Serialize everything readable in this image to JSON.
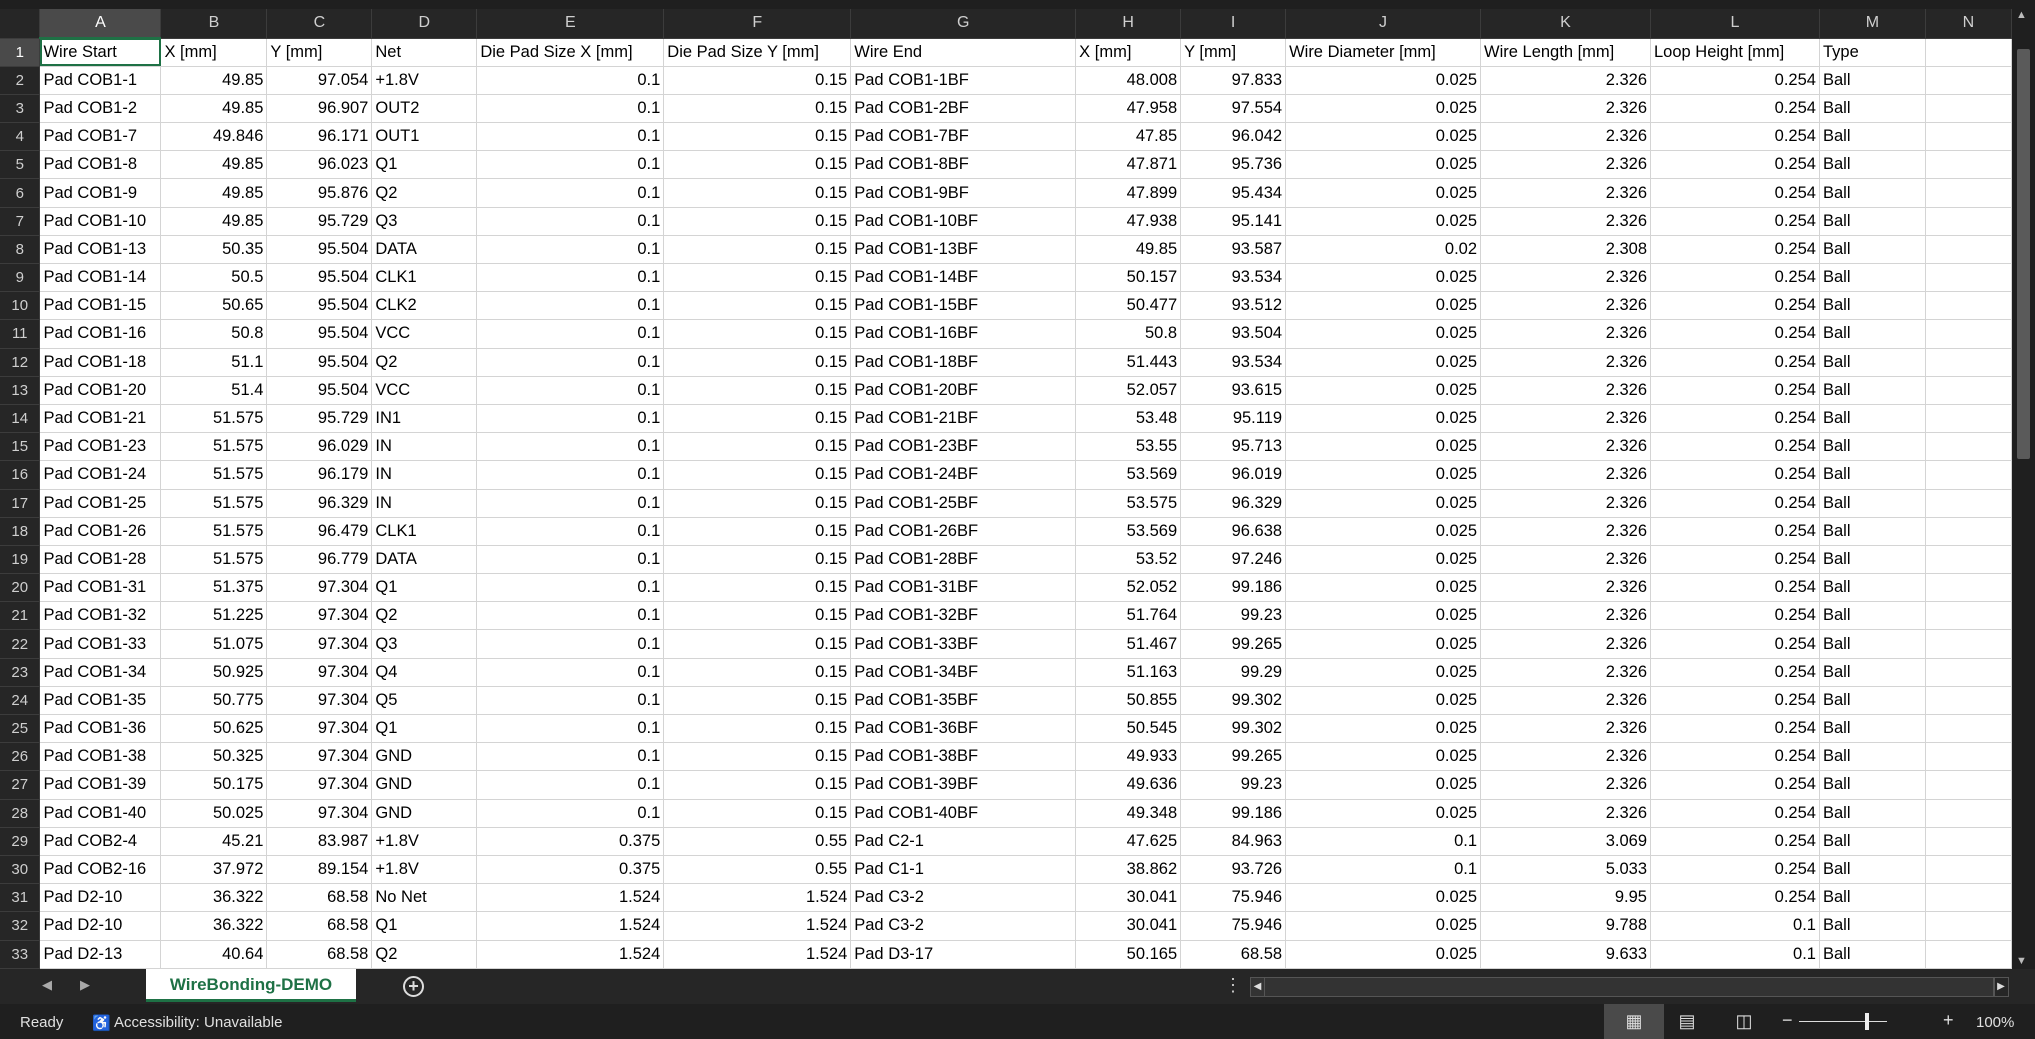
{
  "columns": [
    "A",
    "B",
    "C",
    "D",
    "E",
    "F",
    "G",
    "H",
    "I",
    "J",
    "K",
    "L",
    "M",
    "N"
  ],
  "numeric_columns": [
    1,
    2,
    4,
    5,
    7,
    8,
    9,
    10,
    11
  ],
  "header": [
    "Wire Start",
    "X [mm]",
    "Y [mm]",
    "Net",
    "Die Pad Size X [mm]",
    "Die Pad Size Y [mm]",
    "Wire End",
    "X [mm]",
    "Y [mm]",
    "Wire Diameter [mm]",
    "Wire Length [mm]",
    "Loop Height [mm]",
    "Type",
    ""
  ],
  "rows": [
    [
      "Pad COB1-1",
      "49.85",
      "97.054",
      "+1.8V",
      "0.1",
      "0.15",
      "Pad COB1-1BF",
      "48.008",
      "97.833",
      "0.025",
      "2.326",
      "0.254",
      "Ball"
    ],
    [
      "Pad COB1-2",
      "49.85",
      "96.907",
      "OUT2",
      "0.1",
      "0.15",
      "Pad COB1-2BF",
      "47.958",
      "97.554",
      "0.025",
      "2.326",
      "0.254",
      "Ball"
    ],
    [
      "Pad COB1-7",
      "49.846",
      "96.171",
      "OUT1",
      "0.1",
      "0.15",
      "Pad COB1-7BF",
      "47.85",
      "96.042",
      "0.025",
      "2.326",
      "0.254",
      "Ball"
    ],
    [
      "Pad COB1-8",
      "49.85",
      "96.023",
      "Q1",
      "0.1",
      "0.15",
      "Pad COB1-8BF",
      "47.871",
      "95.736",
      "0.025",
      "2.326",
      "0.254",
      "Ball"
    ],
    [
      "Pad COB1-9",
      "49.85",
      "95.876",
      "Q2",
      "0.1",
      "0.15",
      "Pad COB1-9BF",
      "47.899",
      "95.434",
      "0.025",
      "2.326",
      "0.254",
      "Ball"
    ],
    [
      "Pad COB1-10",
      "49.85",
      "95.729",
      "Q3",
      "0.1",
      "0.15",
      "Pad COB1-10BF",
      "47.938",
      "95.141",
      "0.025",
      "2.326",
      "0.254",
      "Ball"
    ],
    [
      "Pad COB1-13",
      "50.35",
      "95.504",
      "DATA",
      "0.1",
      "0.15",
      "Pad COB1-13BF",
      "49.85",
      "93.587",
      "0.02",
      "2.308",
      "0.254",
      "Ball"
    ],
    [
      "Pad COB1-14",
      "50.5",
      "95.504",
      "CLK1",
      "0.1",
      "0.15",
      "Pad COB1-14BF",
      "50.157",
      "93.534",
      "0.025",
      "2.326",
      "0.254",
      "Ball"
    ],
    [
      "Pad COB1-15",
      "50.65",
      "95.504",
      "CLK2",
      "0.1",
      "0.15",
      "Pad COB1-15BF",
      "50.477",
      "93.512",
      "0.025",
      "2.326",
      "0.254",
      "Ball"
    ],
    [
      "Pad COB1-16",
      "50.8",
      "95.504",
      "VCC",
      "0.1",
      "0.15",
      "Pad COB1-16BF",
      "50.8",
      "93.504",
      "0.025",
      "2.326",
      "0.254",
      "Ball"
    ],
    [
      "Pad COB1-18",
      "51.1",
      "95.504",
      "Q2",
      "0.1",
      "0.15",
      "Pad COB1-18BF",
      "51.443",
      "93.534",
      "0.025",
      "2.326",
      "0.254",
      "Ball"
    ],
    [
      "Pad COB1-20",
      "51.4",
      "95.504",
      "VCC",
      "0.1",
      "0.15",
      "Pad COB1-20BF",
      "52.057",
      "93.615",
      "0.025",
      "2.326",
      "0.254",
      "Ball"
    ],
    [
      "Pad COB1-21",
      "51.575",
      "95.729",
      "IN1",
      "0.1",
      "0.15",
      "Pad COB1-21BF",
      "53.48",
      "95.119",
      "0.025",
      "2.326",
      "0.254",
      "Ball"
    ],
    [
      "Pad COB1-23",
      "51.575",
      "96.029",
      "IN",
      "0.1",
      "0.15",
      "Pad COB1-23BF",
      "53.55",
      "95.713",
      "0.025",
      "2.326",
      "0.254",
      "Ball"
    ],
    [
      "Pad COB1-24",
      "51.575",
      "96.179",
      "IN",
      "0.1",
      "0.15",
      "Pad COB1-24BF",
      "53.569",
      "96.019",
      "0.025",
      "2.326",
      "0.254",
      "Ball"
    ],
    [
      "Pad COB1-25",
      "51.575",
      "96.329",
      "IN",
      "0.1",
      "0.15",
      "Pad COB1-25BF",
      "53.575",
      "96.329",
      "0.025",
      "2.326",
      "0.254",
      "Ball"
    ],
    [
      "Pad COB1-26",
      "51.575",
      "96.479",
      "CLK1",
      "0.1",
      "0.15",
      "Pad COB1-26BF",
      "53.569",
      "96.638",
      "0.025",
      "2.326",
      "0.254",
      "Ball"
    ],
    [
      "Pad COB1-28",
      "51.575",
      "96.779",
      "DATA",
      "0.1",
      "0.15",
      "Pad COB1-28BF",
      "53.52",
      "97.246",
      "0.025",
      "2.326",
      "0.254",
      "Ball"
    ],
    [
      "Pad COB1-31",
      "51.375",
      "97.304",
      "Q1",
      "0.1",
      "0.15",
      "Pad COB1-31BF",
      "52.052",
      "99.186",
      "0.025",
      "2.326",
      "0.254",
      "Ball"
    ],
    [
      "Pad COB1-32",
      "51.225",
      "97.304",
      "Q2",
      "0.1",
      "0.15",
      "Pad COB1-32BF",
      "51.764",
      "99.23",
      "0.025",
      "2.326",
      "0.254",
      "Ball"
    ],
    [
      "Pad COB1-33",
      "51.075",
      "97.304",
      "Q3",
      "0.1",
      "0.15",
      "Pad COB1-33BF",
      "51.467",
      "99.265",
      "0.025",
      "2.326",
      "0.254",
      "Ball"
    ],
    [
      "Pad COB1-34",
      "50.925",
      "97.304",
      "Q4",
      "0.1",
      "0.15",
      "Pad COB1-34BF",
      "51.163",
      "99.29",
      "0.025",
      "2.326",
      "0.254",
      "Ball"
    ],
    [
      "Pad COB1-35",
      "50.775",
      "97.304",
      "Q5",
      "0.1",
      "0.15",
      "Pad COB1-35BF",
      "50.855",
      "99.302",
      "0.025",
      "2.326",
      "0.254",
      "Ball"
    ],
    [
      "Pad COB1-36",
      "50.625",
      "97.304",
      "Q1",
      "0.1",
      "0.15",
      "Pad COB1-36BF",
      "50.545",
      "99.302",
      "0.025",
      "2.326",
      "0.254",
      "Ball"
    ],
    [
      "Pad COB1-38",
      "50.325",
      "97.304",
      "GND",
      "0.1",
      "0.15",
      "Pad COB1-38BF",
      "49.933",
      "99.265",
      "0.025",
      "2.326",
      "0.254",
      "Ball"
    ],
    [
      "Pad COB1-39",
      "50.175",
      "97.304",
      "GND",
      "0.1",
      "0.15",
      "Pad COB1-39BF",
      "49.636",
      "99.23",
      "0.025",
      "2.326",
      "0.254",
      "Ball"
    ],
    [
      "Pad COB1-40",
      "50.025",
      "97.304",
      "GND",
      "0.1",
      "0.15",
      "Pad COB1-40BF",
      "49.348",
      "99.186",
      "0.025",
      "2.326",
      "0.254",
      "Ball"
    ],
    [
      "Pad COB2-4",
      "45.21",
      "83.987",
      "+1.8V",
      "0.375",
      "0.55",
      "Pad C2-1",
      "47.625",
      "84.963",
      "0.1",
      "3.069",
      "0.254",
      "Ball"
    ],
    [
      "Pad COB2-16",
      "37.972",
      "89.154",
      "+1.8V",
      "0.375",
      "0.55",
      "Pad C1-1",
      "38.862",
      "93.726",
      "0.1",
      "5.033",
      "0.254",
      "Ball"
    ],
    [
      "Pad D2-10",
      "36.322",
      "68.58",
      "No Net",
      "1.524",
      "1.524",
      "Pad C3-2",
      "30.041",
      "75.946",
      "0.025",
      "9.95",
      "0.254",
      "Ball"
    ],
    [
      "Pad D2-10",
      "36.322",
      "68.58",
      "Q1",
      "1.524",
      "1.524",
      "Pad C3-2",
      "30.041",
      "75.946",
      "0.025",
      "9.788",
      "0.1",
      "Ball"
    ],
    [
      "Pad D2-13",
      "40.64",
      "68.58",
      "Q2",
      "1.524",
      "1.524",
      "Pad D3-17",
      "50.165",
      "68.58",
      "0.025",
      "9.633",
      "0.1",
      "Ball"
    ]
  ],
  "sheet_tab": "WireBonding-DEMO",
  "status": {
    "ready": "Ready",
    "accessibility": "Accessibility: Unavailable",
    "zoom": "100%",
    "zoom_minus": "−",
    "zoom_plus": "+"
  },
  "accent": "#1e7145"
}
